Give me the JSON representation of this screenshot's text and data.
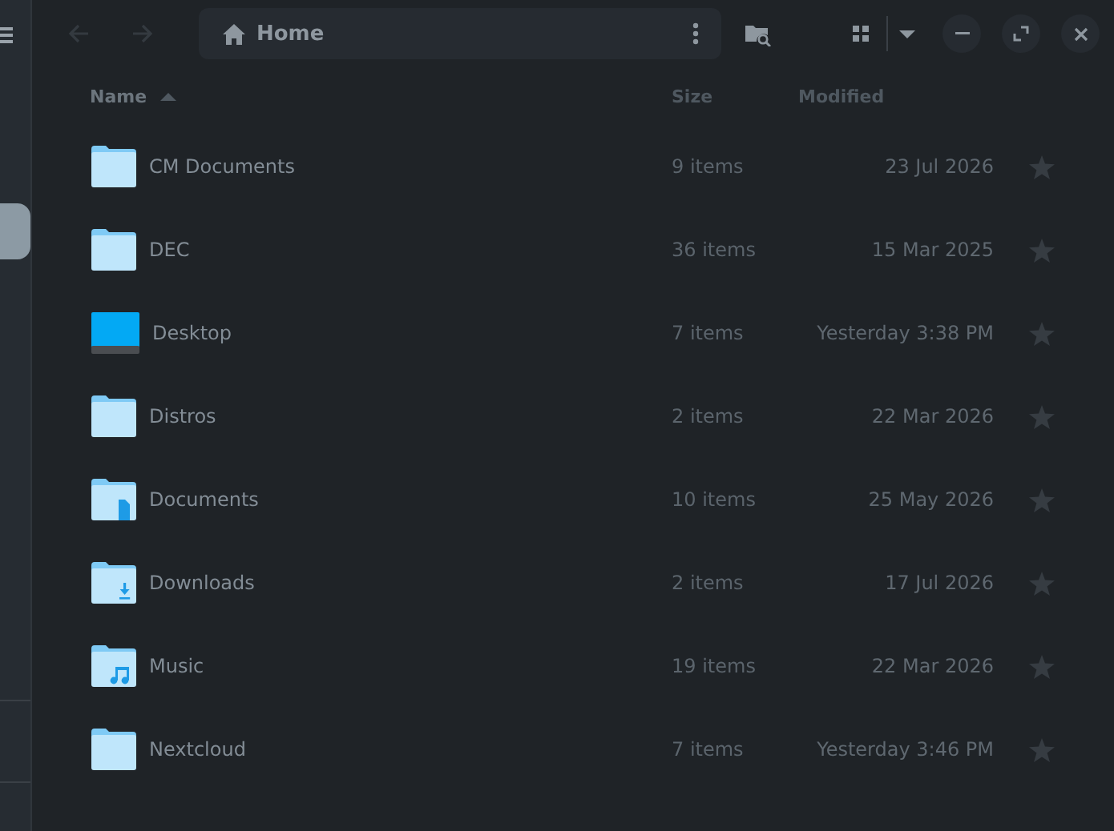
{
  "toolbar": {
    "back_disabled": true,
    "forward_disabled": true,
    "location": "Home"
  },
  "columns": [
    {
      "label": "Name",
      "sorted": true
    },
    {
      "label": "Size",
      "sorted": false
    },
    {
      "label": "Modified",
      "sorted": false
    }
  ],
  "rows": [
    {
      "name": "CM Documents",
      "kind": "folder",
      "size": "9 items",
      "modified": "23 Jul 2026",
      "starred": false
    },
    {
      "name": "DEC",
      "kind": "folder",
      "size": "36 items",
      "modified": "15 Mar 2025",
      "starred": false
    },
    {
      "name": "Desktop",
      "kind": "desktop",
      "size": "7 items",
      "modified": "Yesterday 3:38 PM",
      "starred": false
    },
    {
      "name": "Distros",
      "kind": "folder",
      "size": "2 items",
      "modified": "22 Mar 2026",
      "starred": false
    },
    {
      "name": "Documents",
      "kind": "documents",
      "size": "10 items",
      "modified": "25 May 2026",
      "starred": false
    },
    {
      "name": "Downloads",
      "kind": "downloads",
      "size": "2 items",
      "modified": "17 Jul 2026",
      "starred": false
    },
    {
      "name": "Music",
      "kind": "music",
      "size": "19 items",
      "modified": "22 Mar 2026",
      "starred": false
    },
    {
      "name": "Nextcloud",
      "kind": "folder",
      "size": "7 items",
      "modified": "Yesterday 3:46 PM",
      "starred": false
    }
  ]
}
